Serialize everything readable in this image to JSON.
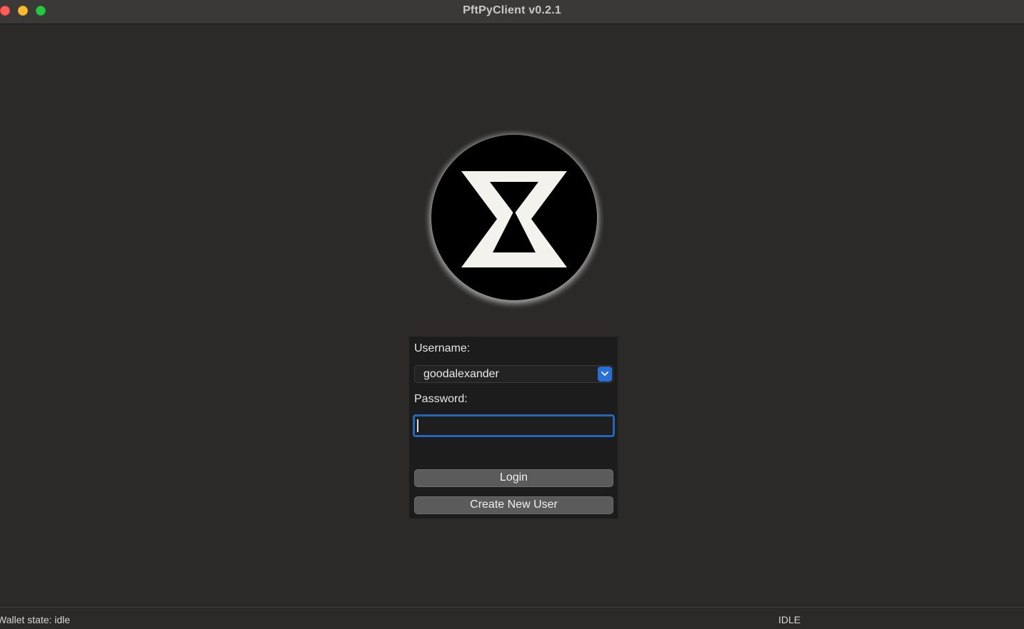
{
  "window": {
    "title": "PftPyClient v0.2.1"
  },
  "logo": {
    "icon": "hourglass-x-logo-icon"
  },
  "login": {
    "username_label": "Username:",
    "username_value": "goodalexander",
    "password_label": "Password:",
    "password_value": "",
    "login_button": "Login",
    "create_button": "Create New User"
  },
  "status": {
    "left_text": "Wallet state: idle",
    "right_text": "IDLE"
  },
  "colors": {
    "background": "#2b2a29",
    "panel": "#1c1c1c",
    "accent": "#2a6fd6",
    "button": "#5b5b5b"
  }
}
